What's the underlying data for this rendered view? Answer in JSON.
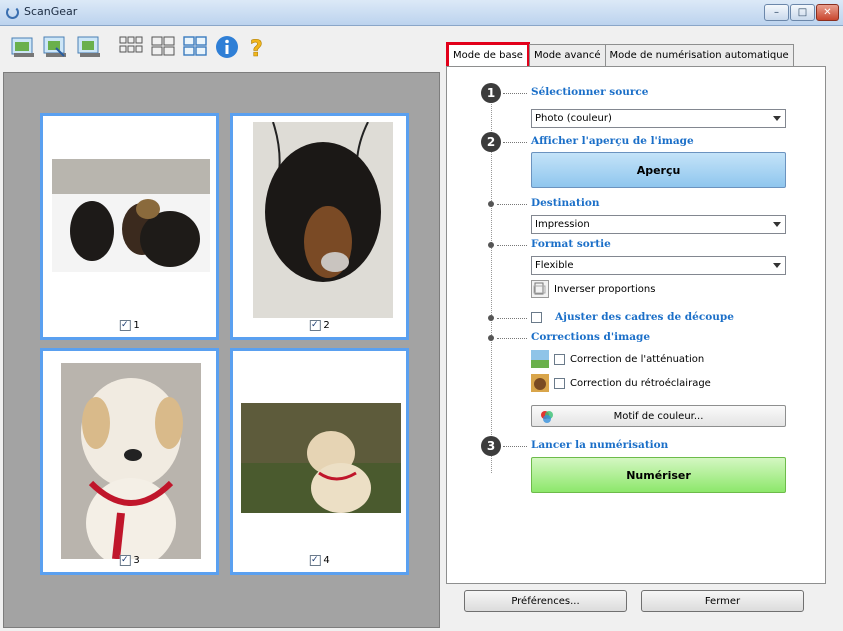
{
  "window": {
    "title": "ScanGear",
    "close_glyph": "✕",
    "max_glyph": "□",
    "min_glyph": "–"
  },
  "toolbar": {
    "icons": [
      "scan-photo-icon",
      "scan-crop-icon",
      "scan-zoom-icon",
      "thumbnail-grid-small-icon",
      "thumbnail-grid-icon",
      "thumbnail-grid-large-icon",
      "info-icon",
      "help-icon"
    ]
  },
  "thumbnails": [
    {
      "label": "1",
      "checked": true,
      "check_glyph": "✓"
    },
    {
      "label": "2",
      "checked": true,
      "check_glyph": "✓"
    },
    {
      "label": "3",
      "checked": true,
      "check_glyph": "✓"
    },
    {
      "label": "4",
      "checked": true,
      "check_glyph": "✓"
    }
  ],
  "tabs": [
    {
      "label": "Mode de base",
      "active": true
    },
    {
      "label": "Mode avancé",
      "active": false
    },
    {
      "label": "Mode de numérisation automatique",
      "active": false
    }
  ],
  "steps": {
    "s1": {
      "num": "1",
      "title": "Sélectionner source",
      "select_value": "Photo (couleur)"
    },
    "s2": {
      "num": "2",
      "title": "Afficher l'aperçu de l'image",
      "button": "Aperçu"
    },
    "destination": {
      "title": "Destination",
      "select_value": "Impression"
    },
    "format": {
      "title": "Format sortie",
      "select_value": "Flexible",
      "invert_label": "Inverser proportions"
    },
    "crop": {
      "label": "Ajuster des cadres de découpe"
    },
    "corrections": {
      "title": "Corrections d'image",
      "fade_label": "Correction de l'atténuation",
      "backlight_label": "Correction du rétroéclairage",
      "color_pattern_button": "Motif de couleur..."
    },
    "s3": {
      "num": "3",
      "title": "Lancer la numérisation",
      "button": "Numériser"
    }
  },
  "bottom": {
    "preferences": "Préférences...",
    "close": "Fermer"
  },
  "colors": {
    "accent_blue": "#1b6fc8",
    "tab_highlight": "#e2001a",
    "thumb_border": "#5aa0f0"
  }
}
